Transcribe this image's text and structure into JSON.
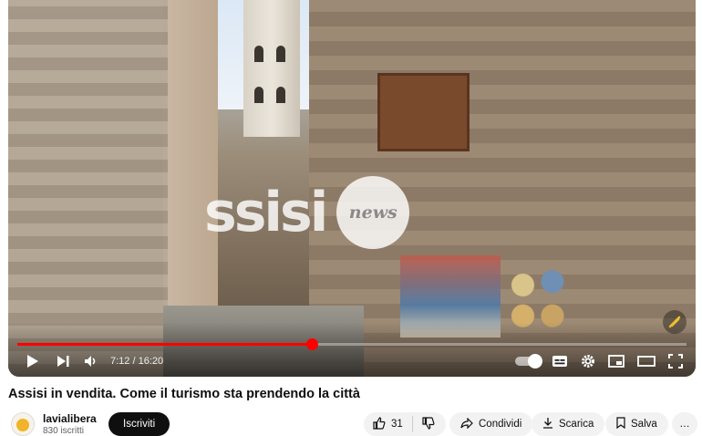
{
  "player": {
    "watermark_big": "ssisi",
    "watermark_small": "news",
    "progress_fraction": 0.44,
    "time_label": "7:12 / 16:20",
    "accent_color": "#ff0000",
    "icons": [
      "play-icon",
      "next-icon",
      "volume-icon",
      "autoplay-toggle",
      "subtitles-icon",
      "settings-icon",
      "miniplayer-icon",
      "theater-icon",
      "fullscreen-icon"
    ]
  },
  "video": {
    "title": "Assisi in vendita. Come il turismo sta prendendo la città"
  },
  "channel": {
    "name": "lavialibera",
    "subscribers": "830 iscritti",
    "subscribe_label": "Iscriviti"
  },
  "actions": {
    "like_count": "31",
    "share_label": "Condividi",
    "download_label": "Scarica",
    "save_label": "Salva",
    "more_label": "…"
  }
}
